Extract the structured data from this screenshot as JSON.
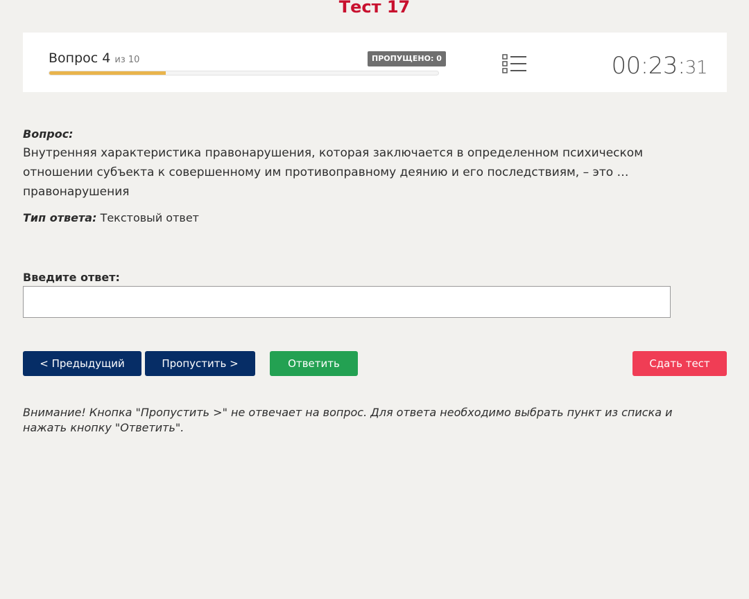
{
  "page": {
    "title": "Тест 17"
  },
  "status": {
    "question_label": "Вопрос 4",
    "question_of": "из 10",
    "skipped_badge": "ПРОПУЩЕНО: 0",
    "progress_percent": 30,
    "list_icon": "list-icon",
    "timer_main": "00:23:",
    "timer_seconds": "31"
  },
  "question": {
    "label": "Вопрос:",
    "text": "Внутренняя характеристика правонарушения, которая заключается в определенном психическом отношении субъекта к совершенному им противоправному деянию и его последствиям, – это … правонарушения",
    "answer_type_label": "Тип ответа:",
    "answer_type_value": "Текстовый ответ"
  },
  "answer": {
    "label": "Введите ответ:",
    "value": ""
  },
  "buttons": {
    "prev": "< Предыдущий",
    "skip": "Пропустить >",
    "answer": "Ответить",
    "submit": "Сдать тест"
  },
  "colors": {
    "title": "#c8102e",
    "progress": "#e9b44c",
    "nav_button": "#062d66",
    "answer_button": "#23a152",
    "submit_button": "#f03d55"
  },
  "warning": {
    "text": "Внимание! Кнопка \"Пропустить >\" не отвечает на вопрос. Для ответа необходимо выбрать пункт из списка и нажать кнопку \"Ответить\"."
  }
}
